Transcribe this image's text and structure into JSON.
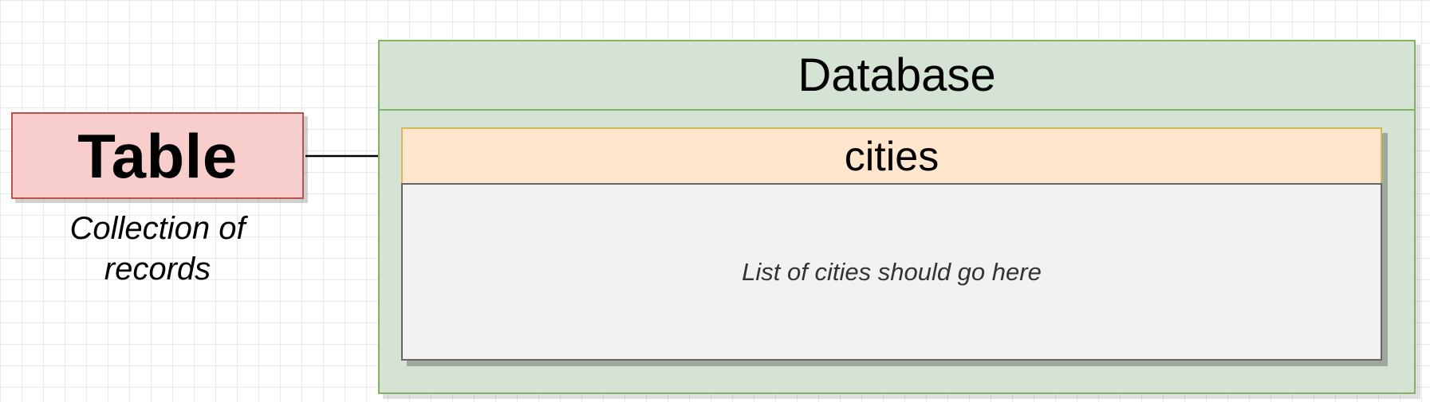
{
  "diagram": {
    "table_concept": {
      "label": "Table",
      "caption_line1": "Collection of",
      "caption_line2": "records"
    },
    "database": {
      "title": "Database",
      "table": {
        "name": "cities",
        "placeholder": "List of cities should go here"
      }
    },
    "colors": {
      "table_fill": "#f8cecc",
      "table_stroke": "#b85450",
      "database_fill": "#d5e3d4",
      "database_stroke": "#82b366",
      "cities_header_fill": "#ffe6cc",
      "cities_header_stroke": "#d6b656",
      "cities_body_fill": "#f2f2f2",
      "cities_body_stroke": "#666666"
    }
  }
}
